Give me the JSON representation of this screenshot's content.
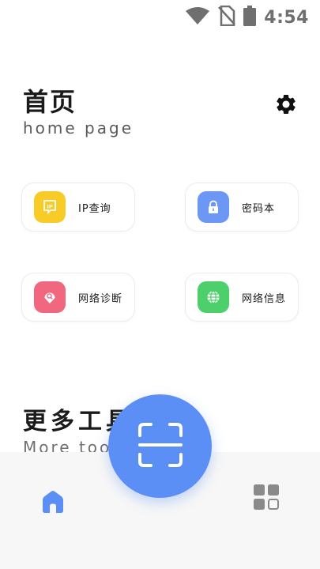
{
  "status_bar": {
    "time": "4:54",
    "icons": [
      "wifi-icon",
      "no-sim-icon",
      "battery-icon"
    ]
  },
  "header": {
    "title": "首页",
    "subtitle": "home page",
    "settings_icon": "gear-icon"
  },
  "tools": [
    {
      "label": "IP查询",
      "icon": "ip-tag-icon",
      "color": "#f9cb27"
    },
    {
      "label": "密码本",
      "icon": "lock-icon",
      "color": "#6d97f5"
    },
    {
      "label": "网络诊断",
      "icon": "search-shield-icon",
      "color": "#f0677f"
    },
    {
      "label": "网络信息",
      "icon": "globe-icon",
      "color": "#4dd06b"
    }
  ],
  "more_tools": {
    "title": "更多工具",
    "subtitle": "More tools"
  },
  "bottom_nav": {
    "home_icon": "home-icon",
    "scan_icon": "scan-icon",
    "apps_icon": "apps-grid-icon"
  },
  "colors": {
    "accent": "#5b8ff5",
    "nav_active": "#5b8ff5",
    "nav_inactive": "#8a8a8a"
  }
}
